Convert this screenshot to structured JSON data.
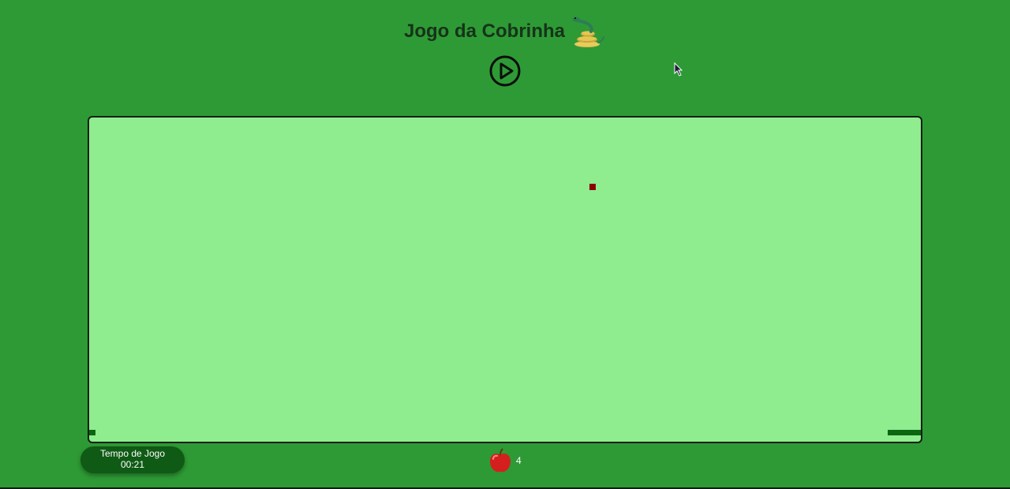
{
  "header": {
    "title": "Jogo da Cobrinha",
    "title_icon": "snake-icon"
  },
  "controls": {
    "play_icon": "play-circle-icon"
  },
  "board": {
    "background_color": "#8fec8f",
    "food_color": "#8b0000",
    "snake_color": "#0a6610"
  },
  "status": {
    "timer_label": "Tempo de Jogo",
    "timer_value": "00:21",
    "score_icon": "apple-icon",
    "score_value": "4"
  },
  "colors": {
    "page_background": "#2e9a35",
    "title_color": "#16331a",
    "timer_background": "#0f5a14"
  }
}
